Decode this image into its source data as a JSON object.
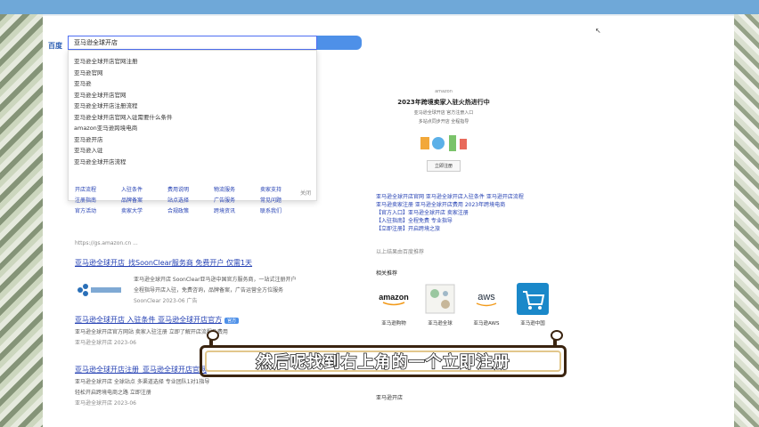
{
  "logo": "百度",
  "search": {
    "value": "亚马逊全球开店"
  },
  "suggestions": [
    "亚马逊全球开店官网注册",
    "亚马逊官网",
    "亚马逊",
    "亚马逊全球开店官网",
    "亚马逊全球开店注册流程",
    "亚马逊全球开店官网入驻需要什么条件",
    "amazon亚马逊跨境电商",
    "亚马逊开店",
    "亚马逊入驻",
    "亚马逊全球开店流程"
  ],
  "suggest_close": "关闭",
  "nav_grid": [
    [
      "开店流程",
      "入驻条件",
      "费用说明",
      "物流服务",
      "卖家支持"
    ],
    [
      "注册指南",
      "品牌备案",
      "站点选择",
      "广告服务",
      "常见问题"
    ],
    [
      "官方活动",
      "卖家大学",
      "合规政策",
      "跨境资讯",
      "联系我们"
    ]
  ],
  "url_line": "https://gs.amazon.cn ...",
  "results": [
    {
      "title": "亚马逊全球开店_找SoonClear服务商 免费开户 仅需1天",
      "lines": [
        "亚马逊全球开店 SoonClear亚马逊中国官方服务商，一站式注册开户",
        "全程指导开店入驻，免费咨询，品牌备案，广告运营全方位服务"
      ],
      "meta": "SoonClear 2023-06 广告"
    },
    {
      "title": "亚马逊全球开店 入驻条件 亚马逊全球开店官方",
      "lines": [
        "亚马逊全球开店官方网站 卖家入驻注册 立即了解开店流程及费用"
      ],
      "meta": "亚马逊全球开店 2023-06"
    },
    {
      "title": "亚马逊全球开店注册_亚马逊全球开店官网",
      "lines": [
        "亚马逊全球开店 全球站点 多渠道选择 专业团队1对1指导",
        "轻松开启跨境电商之路 立即注册"
      ],
      "meta": "亚马逊全球开店 2023-06"
    }
  ],
  "right_banner": {
    "brand": "amazon",
    "headline": "2023年跨境卖家入驻火热进行中",
    "sub1": "亚马逊全球开店 官方注册入口",
    "sub2": "多站点同步开店 全程指导",
    "button": "立即注册"
  },
  "right_text": [
    "亚马逊全球开店官网    亚马逊全球开店入驻条件    亚马逊开店流程",
    "亚马逊卖家注册    亚马逊全球开店费用    2023年跨境电商",
    "【官方入口】亚马逊全球开店 卖家注册",
    "【入驻指南】全程免费 专业指导",
    "【立即注册】开启跨境之旅"
  ],
  "right_hint": "以上结果由百度推荐",
  "related_title": "相关推荐",
  "related": [
    {
      "name": "亚马逊购物",
      "logo": "amazon"
    },
    {
      "name": "亚马逊全球",
      "logo": "pattern"
    },
    {
      "name": "亚马逊AWS",
      "logo": "aws"
    },
    {
      "name": "亚马逊中国",
      "logo": "cart"
    }
  ],
  "bottom_row": "亚马逊开店",
  "subtitle": "然后呢找到右上角的一个立即注册",
  "colors": {
    "link": "#2440b3",
    "accent": "#4e90e8",
    "topbar": "#6fa8d8"
  }
}
